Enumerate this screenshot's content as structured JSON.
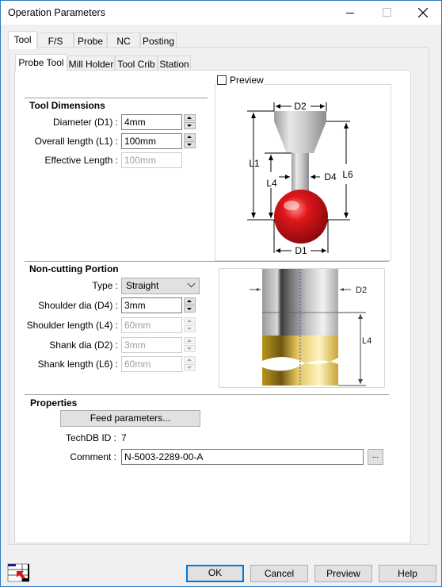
{
  "window": {
    "title": "Operation Parameters",
    "controls": {
      "minimize": "minimize",
      "maximize": "maximize",
      "close": "close"
    }
  },
  "tabs": [
    {
      "label": "Tool",
      "active": true
    },
    {
      "label": "F/S",
      "active": false
    },
    {
      "label": "Probe",
      "active": false
    },
    {
      "label": "NC",
      "active": false
    },
    {
      "label": "Posting",
      "active": false
    }
  ],
  "subtabs": [
    {
      "label": "Probe Tool",
      "active": true
    },
    {
      "label": "Mill Holder",
      "active": false
    },
    {
      "label": "Tool Crib",
      "active": false
    },
    {
      "label": "Station",
      "active": false
    }
  ],
  "preview_checkbox": {
    "label": "Preview",
    "checked": false
  },
  "tool_dimensions": {
    "title": "Tool Dimensions",
    "diameter": {
      "label": "Diameter (D1) :",
      "value": "4mm"
    },
    "overall_length": {
      "label": "Overall length (L1) :",
      "value": "100mm"
    },
    "effective_length": {
      "label": "Effective Length :",
      "value": "100mm"
    }
  },
  "probe_diagram": {
    "labels": {
      "d2": "D2",
      "l1": "L1",
      "l4": "L4",
      "d4": "D4",
      "l6": "L6",
      "d1": "D1"
    },
    "colors": {
      "ball": "#e0161b",
      "shank": "#c8c8c8"
    }
  },
  "non_cutting": {
    "title": "Non-cutting Portion",
    "type": {
      "label": "Type :",
      "value": "Straight"
    },
    "shoulder_dia": {
      "label": "Shoulder dia (D4) :",
      "value": "3mm"
    },
    "shoulder_length": {
      "label": "Shoulder length (L4) :",
      "value": "60mm"
    },
    "shank_dia": {
      "label": "Shank dia (D2) :",
      "value": "3mm"
    },
    "shank_length": {
      "label": "Shank length (L6) :",
      "value": "60mm"
    }
  },
  "shank_diagram": {
    "labels": {
      "d2": "D2",
      "l4": "L4"
    },
    "colors": {
      "steel": "#b9b9b9",
      "brass": "#d4b032"
    }
  },
  "properties": {
    "title": "Properties",
    "feed_button": "Feed parameters...",
    "techdb_label": "TechDB ID :",
    "techdb_value": "7",
    "comment_label": "Comment :",
    "comment_value": "N-5003-2289-00-A",
    "browse_button": "..."
  },
  "footer": {
    "ok": "OK",
    "cancel": "Cancel",
    "preview": "Preview",
    "help": "Help"
  }
}
